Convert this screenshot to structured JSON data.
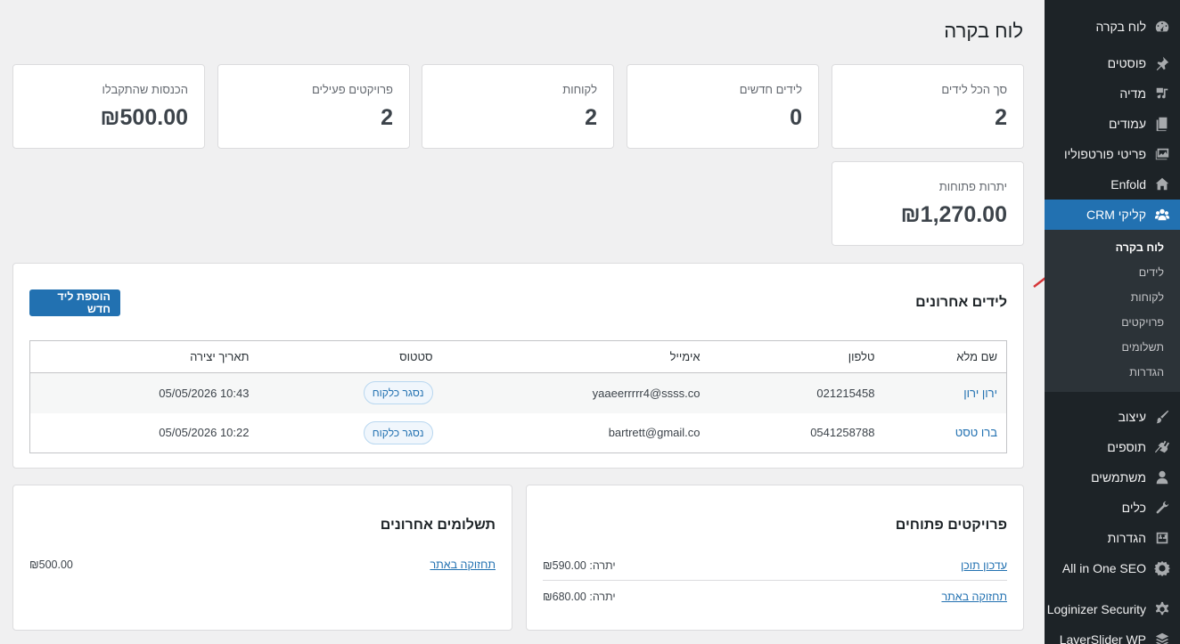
{
  "page": {
    "title": "לוח בקרה"
  },
  "stats": {
    "total_leads": {
      "label": "סך הכל לידים",
      "value": "2"
    },
    "new_leads": {
      "label": "לידים חדשים",
      "value": "0"
    },
    "clients": {
      "label": "לקוחות",
      "value": "2"
    },
    "active_projects": {
      "label": "פרויקטים פעילים",
      "value": "2"
    },
    "income": {
      "label": "הכנסות שהתקבלו",
      "value": "₪500.00"
    },
    "open_balances": {
      "label": "יתרות פתוחות",
      "value": "₪1,270.00"
    }
  },
  "recent_leads": {
    "title": "לידים אחרונים",
    "add_button": "הוספת ליד חדש",
    "columns": [
      "שם מלא",
      "טלפון",
      "אימייל",
      "סטטוס",
      "תאריך יצירה"
    ],
    "rows": [
      {
        "name": "ירון ירון",
        "phone": "021215458",
        "email": "yaaeerrrrr4@ssss.co",
        "status": "נסגר כלקוח",
        "date": "05/05/2026 10:43"
      },
      {
        "name": "ברו טסט",
        "phone": "0541258788",
        "email": "bartrett@gmail.co",
        "status": "נסגר כלקוח",
        "date": "05/05/2026 10:22"
      }
    ]
  },
  "open_projects": {
    "title": "פרויקטים פתוחים",
    "items": [
      {
        "name": "עדכון תוכן",
        "balance_label": "יתרה:",
        "balance": "₪590.00"
      },
      {
        "name": "תחזוקה באתר",
        "balance_label": "יתרה:",
        "balance": "₪680.00"
      }
    ]
  },
  "recent_payments": {
    "title": "תשלומים אחרונים",
    "items": [
      {
        "name": "תחזוקה באתר",
        "amount": "₪500.00"
      }
    ]
  },
  "sidebar": {
    "items": [
      {
        "label": "לוח בקרה",
        "icon": "dashboard-icon"
      },
      {
        "label": "פוסטים",
        "icon": "pin-icon"
      },
      {
        "label": "מדיה",
        "icon": "media-icon"
      },
      {
        "label": "עמודים",
        "icon": "pages-icon"
      },
      {
        "label": "פריטי פורטפוליו",
        "icon": "portfolio-icon"
      },
      {
        "label": "Enfold",
        "icon": "home-icon"
      },
      {
        "label": "קליקי CRM",
        "icon": "groups-icon"
      }
    ],
    "submenu": [
      {
        "label": "לוח בקרה"
      },
      {
        "label": "לידים"
      },
      {
        "label": "לקוחות"
      },
      {
        "label": "פרויקטים"
      },
      {
        "label": "תשלומים"
      },
      {
        "label": "הגדרות"
      }
    ],
    "items_after": [
      {
        "label": "עיצוב",
        "icon": "brush-icon"
      },
      {
        "label": "תוספים",
        "icon": "plugin-icon"
      },
      {
        "label": "משתמשים",
        "icon": "users-icon"
      },
      {
        "label": "כלים",
        "icon": "wrench-icon"
      },
      {
        "label": "הגדרות",
        "icon": "settings-icon"
      },
      {
        "label": "All in One SEO",
        "icon": "seo-icon"
      },
      {
        "label": "Loginizer Security",
        "icon": "gear-icon"
      },
      {
        "label": "LayerSlider WP",
        "icon": "layers-icon"
      }
    ]
  },
  "colors": {
    "accent": "#2271b1",
    "sidebar_bg": "#1d2327",
    "annotation_arrow": "#d63638"
  }
}
